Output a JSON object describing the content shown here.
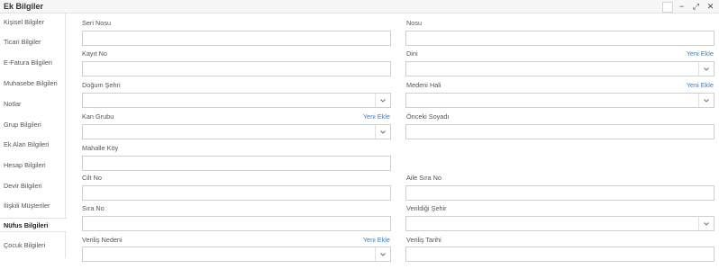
{
  "window": {
    "title": "Ek Bilgiler",
    "controls": [
      {
        "name": "square-box-icon",
        "glyph": ""
      },
      {
        "name": "minimize-icon",
        "glyph": "−"
      },
      {
        "name": "expand-icon",
        "glyph": "⤢"
      },
      {
        "name": "close-icon",
        "glyph": "✕"
      }
    ]
  },
  "sidebar": {
    "items": [
      {
        "label": "Kişisel Bilgiler"
      },
      {
        "label": "Ticari Bilgiler"
      },
      {
        "label": "E-Fatura Bilgileri"
      },
      {
        "label": "Muhasebe Bilgileri"
      },
      {
        "label": "Notlar"
      },
      {
        "label": "Grup Bilgileri"
      },
      {
        "label": "Ek Alan Bilgileri"
      },
      {
        "label": "Hesap Bilgileri"
      },
      {
        "label": "Devir Bilgileri"
      },
      {
        "label": "İlişkili Müşteriler"
      },
      {
        "label": "Nüfus Bilgileri",
        "active": true
      },
      {
        "label": "Çocuk Bilgileri"
      }
    ]
  },
  "form": {
    "add_new_label": "Yeni Ekle",
    "seri_nosu": {
      "label": "Seri Nosu",
      "value": ""
    },
    "nosu": {
      "label": "Nosu",
      "value": ""
    },
    "kayit_no": {
      "label": "Kayıt No",
      "value": ""
    },
    "dini": {
      "label": "Dini",
      "value": ""
    },
    "dogum_sehri": {
      "label": "Doğum Şehri",
      "value": ""
    },
    "medeni_hali": {
      "label": "Medeni Hali",
      "value": ""
    },
    "kan_grubu": {
      "label": "Kan Grubu",
      "value": ""
    },
    "onceki_soyadi": {
      "label": "Önceki Soyadı",
      "value": ""
    },
    "mahalle_koy": {
      "label": "Mahalle Köy",
      "value": ""
    },
    "cilt_no": {
      "label": "Cilt No",
      "value": ""
    },
    "aile_sira_no": {
      "label": "Aile Sıra No",
      "value": ""
    },
    "sira_no": {
      "label": "Sıra No",
      "value": ""
    },
    "verildigi_sehir": {
      "label": "Verildiği Şehir",
      "value": ""
    },
    "verilis_nedeni": {
      "label": "Veriliş Nedeni",
      "value": ""
    },
    "verilis_tarihi": {
      "label": "Veriliş Tarihi",
      "value": ""
    }
  }
}
